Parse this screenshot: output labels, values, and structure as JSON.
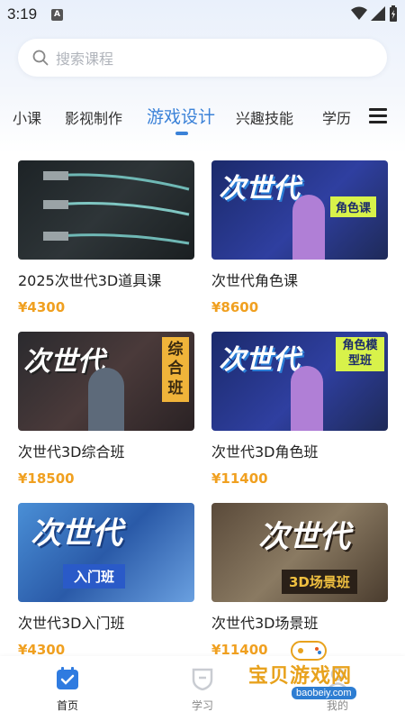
{
  "status_bar": {
    "time": "3:19",
    "notification_icon": "A"
  },
  "search": {
    "placeholder": "搜索课程"
  },
  "tabs": [
    {
      "label": "小课"
    },
    {
      "label": "影视制作"
    },
    {
      "label": "游戏设计"
    },
    {
      "label": "兴趣技能"
    },
    {
      "label": "学历"
    }
  ],
  "active_tab": "游戏设计",
  "courses": [
    {
      "title": "2025次世代3D道具课",
      "price": "¥4300",
      "banner": ""
    },
    {
      "title": "次世代角色课",
      "price": "¥8600",
      "banner": "次世代",
      "tag": "角色课"
    },
    {
      "title": "次世代3D综合班",
      "price": "¥18500",
      "banner": "次世代",
      "tag": "综合班"
    },
    {
      "title": "次世代3D角色班",
      "price": "¥11400",
      "banner": "次世代",
      "tag": "角色模型班"
    },
    {
      "title": "次世代3D入门班",
      "price": "¥4300",
      "banner": "次世代",
      "tag": "入门班"
    },
    {
      "title": "次世代3D场景班",
      "price": "¥11400",
      "banner": "次世代",
      "tag": "3D场景班"
    }
  ],
  "bottom_nav": [
    {
      "label": "首页",
      "active": true
    },
    {
      "label": "学习",
      "active": false
    },
    {
      "label": "我的",
      "active": false
    }
  ],
  "watermark": {
    "text": "宝贝游戏网",
    "url": "baobeiy.com"
  },
  "colors": {
    "accent": "#3b82d8",
    "price": "#f0a020"
  }
}
